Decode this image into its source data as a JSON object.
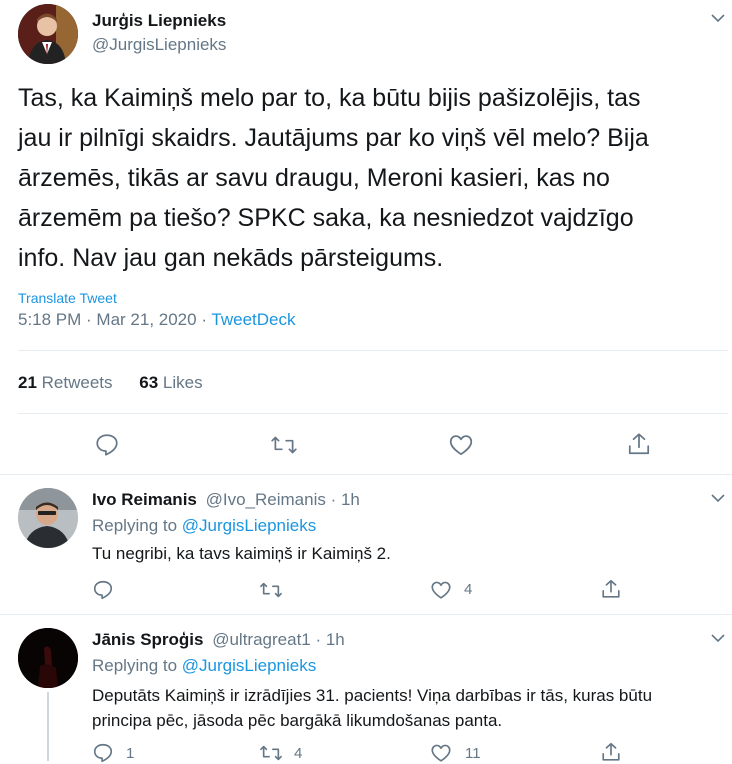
{
  "main_tweet": {
    "author_name": "Jurģis Liepnieks",
    "handle": "@JurgisLiepnieks",
    "text_lines": [
      "Tas, ka Kaimiņš melo par to, ka būtu bijis pašizolējis, tas",
      "jau ir pilnīgi skaidrs. Jautājums par ko viņš vēl melo? Bija",
      "ārzemēs, tikās ar savu draugu, Meroni kasieri, kas no",
      "ārzemēm pa tiešo? SPKC saka, ka nesniedzot vajdzīgo",
      "info. Nav jau gan nekāds pārsteigums."
    ],
    "translate_label": "Translate Tweet",
    "timestamp": "5:18 PM · Mar 21, 2020 · ",
    "source": "TweetDeck",
    "retweets_count": "21",
    "retweets_label": " Retweets",
    "likes_count": "63",
    "likes_label": " Likes"
  },
  "replies": [
    {
      "name": "Ivo Reimanis",
      "handle_time": "@Ivo_Reimanis · 1h",
      "replying_prefix": "Replying to ",
      "replying_handle": "@JurgisLiepnieks",
      "text_lines": [
        "Tu negribi, ka tavs kaimiņš ir Kaimiņš 2."
      ],
      "reply_count": "",
      "retweet_count": "",
      "like_count": "4"
    },
    {
      "name": "Jānis Sproģis",
      "handle_time": "@ultragreat1 · 1h",
      "replying_prefix": "Replying to ",
      "replying_handle": "@JurgisLiepnieks",
      "text_lines": [
        "Deputāts Kaimiņš ir izrādījies 31. pacients! Viņa darbības ir tās, kuras būtu",
        "principa pēc, jāsoda pēc bargākā likumdošanas panta."
      ],
      "reply_count": "1",
      "retweet_count": "4",
      "like_count": "11"
    }
  ],
  "colors": {
    "link": "#1b95e0",
    "secondary": "#657786",
    "divider": "#e6ecf0"
  },
  "icons": [
    "chevron-down-icon",
    "reply-icon",
    "retweet-icon",
    "like-icon",
    "share-icon"
  ]
}
